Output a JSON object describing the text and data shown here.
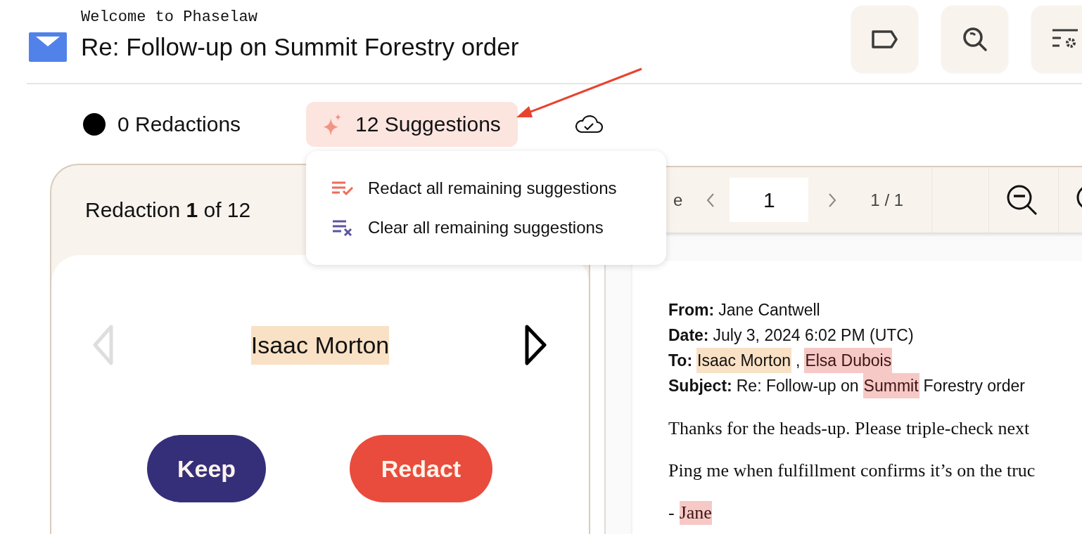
{
  "header": {
    "subtitle": "Welcome to Phaselaw",
    "title": "Re: Follow-up on Summit Forestry order"
  },
  "header_buttons": [
    {
      "kind": "label"
    },
    {
      "kind": "search"
    },
    {
      "kind": "settings"
    }
  ],
  "status": {
    "redactions": "0 Redactions",
    "suggestions": "12 Suggestions",
    "saved": true
  },
  "suggestions_menu": [
    {
      "kind": "redact",
      "label": "Redact all remaining suggestions"
    },
    {
      "kind": "clear",
      "label": "Clear all remaining suggestions"
    }
  ],
  "review": {
    "counter": "Redaction **1** of 12",
    "current": "Isaac Morton",
    "prev_disabled": true,
    "next_disabled": false,
    "buttons": [
      {
        "kind": "keep",
        "label": "Keep"
      },
      {
        "kind": "redact",
        "label": "Redact"
      }
    ]
  },
  "viewer": {
    "toolbar_label": "e",
    "page_input": "1",
    "page_count": "1 / 1"
  },
  "document": {
    "headers": [
      {
        "label": "From:",
        "parts": [
          {
            "kind": "plain",
            "text": "Jane Cantwell"
          }
        ]
      },
      {
        "label": "Date:",
        "parts": [
          {
            "kind": "plain",
            "text": "July 3, 2024 6:02 PM (UTC)"
          }
        ]
      },
      {
        "label": "To:",
        "parts": [
          {
            "kind": "current",
            "text": "Isaac Morton"
          },
          {
            "kind": "plain",
            "text": ","
          },
          {
            "kind": "suggested",
            "text": "Elsa Dubois"
          }
        ]
      },
      {
        "label": "Subject:",
        "parts": [
          {
            "kind": "plain",
            "text": "Re: Follow-up on"
          },
          {
            "kind": "suggested",
            "text": "Summit"
          },
          {
            "kind": "plain",
            "text": "Forestry order"
          }
        ]
      }
    ],
    "body": [
      [
        {
          "kind": "plain",
          "text": "Thanks for the heads-up. Please triple-check next"
        }
      ],
      [
        {
          "kind": "plain",
          "text": "Ping me when fulfillment confirms it’s on the truc"
        }
      ],
      [
        {
          "kind": "plain",
          "text": "-"
        },
        {
          "kind": "suggested",
          "text": "Jane"
        }
      ]
    ]
  }
}
